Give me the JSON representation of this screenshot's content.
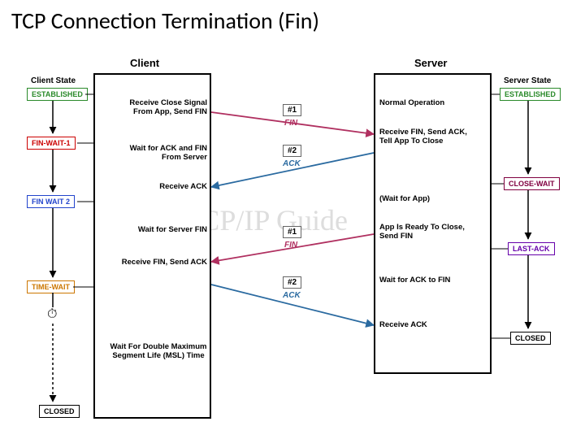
{
  "title": "TCP Connection Termination (Fin)",
  "headers": {
    "client": "Client",
    "server": "Server",
    "client_state": "Client State",
    "server_state": "Server State"
  },
  "client_states": {
    "established": "ESTABLISHED",
    "fin_wait_1": "FIN-WAIT-1",
    "fin_wait_2": "FIN WAIT 2",
    "time_wait": "TIME-WAIT",
    "closed": "CLOSED"
  },
  "server_states": {
    "established": "ESTABLISHED",
    "close_wait": "CLOSE-WAIT",
    "last_ack": "LAST-ACK",
    "closed": "CLOSED"
  },
  "client_events": {
    "e1": "Receive Close Signal From App, Send FIN",
    "e2": "Wait for ACK and FIN From Server",
    "e3": "Receive ACK",
    "e4": "Wait for Server FIN",
    "e5": "Receive FIN, Send ACK",
    "e6": "Wait For Double Maximum Segment Life (MSL) Time"
  },
  "server_events": {
    "e1": "Normal Operation",
    "e2": "Receive FIN, Send ACK, Tell App To Close",
    "e3": "(Wait for App)",
    "e4": "App Is Ready To Close, Send FIN",
    "e5": "Wait for ACK to FIN",
    "e6": "Receive ACK"
  },
  "messages": {
    "m1_label": "#1",
    "m1_type": "FIN",
    "m2_label": "#2",
    "m2_type": "ACK",
    "m3_label": "#1",
    "m3_type": "FIN",
    "m4_label": "#2",
    "m4_type": "ACK"
  },
  "watermark": "The TCP/IP Guide",
  "clock_icon": "⏱"
}
